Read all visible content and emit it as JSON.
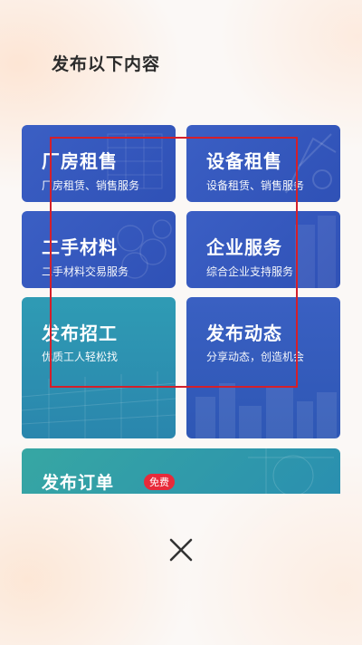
{
  "header": {
    "title": "发布以下内容"
  },
  "cards": [
    {
      "title": "厂房租售",
      "subtitle": "厂房租赁、销售服务"
    },
    {
      "title": "设备租售",
      "subtitle": "设备租赁、销售服务"
    },
    {
      "title": "二手材料",
      "subtitle": "二手材料交易服务"
    },
    {
      "title": "企业服务",
      "subtitle": "综合企业支持服务"
    },
    {
      "title": "发布招工",
      "subtitle": "优质工人轻松找"
    },
    {
      "title": "发布动态",
      "subtitle": "分享动态，创造机会"
    }
  ],
  "order": {
    "title": "发布订单",
    "badge": "免费"
  },
  "icons": {
    "close": "close-icon"
  },
  "colors": {
    "card_blue": "#3354bb",
    "card_teal": "#2c94b2",
    "badge_red": "#e82a3a",
    "highlight_red": "#d41f2a"
  }
}
